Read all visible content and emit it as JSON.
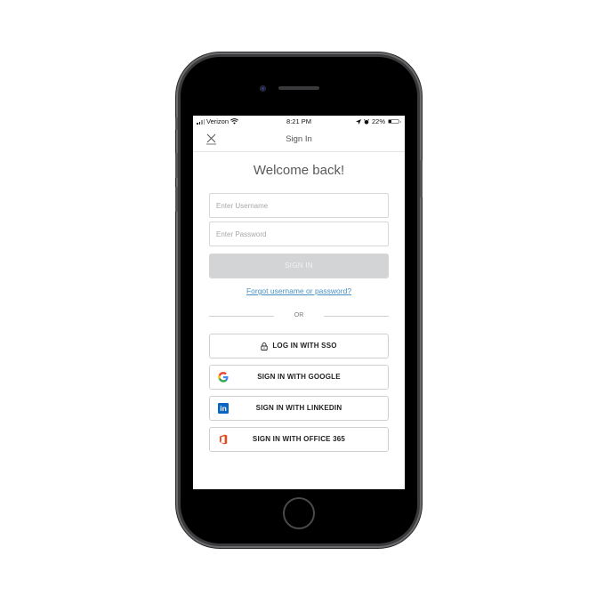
{
  "status_bar": {
    "carrier": "Verizon",
    "time": "8:21 PM",
    "battery_percent": "22%",
    "battery_level": 0.22,
    "icons": [
      "signal-icon",
      "wifi-icon",
      "location-icon",
      "alarm-icon",
      "battery-icon"
    ]
  },
  "nav": {
    "close_icon": "close-icon",
    "title": "Sign In"
  },
  "main": {
    "heading": "Welcome back!",
    "username": {
      "value": "",
      "placeholder": "Enter Username"
    },
    "password": {
      "value": "",
      "placeholder": "Enter Password"
    },
    "signin_label": "SIGN IN",
    "forgot_link": "Forgot username or password?",
    "divider_text": "OR"
  },
  "social_buttons": [
    {
      "label": "LOG IN WITH SSO",
      "icon": "lock-icon"
    },
    {
      "label": "SIGN IN WITH GOOGLE",
      "icon": "google-icon"
    },
    {
      "label": "SIGN IN WITH LINKEDIN",
      "icon": "linkedin-icon"
    },
    {
      "label": "SIGN IN WITH OFFICE 365",
      "icon": "office365-icon"
    }
  ],
  "colors": {
    "link": "#4a90c2",
    "signin_disabled": "#d3d4d6",
    "linkedin": "#0a66c2",
    "office": "#e8491d"
  }
}
